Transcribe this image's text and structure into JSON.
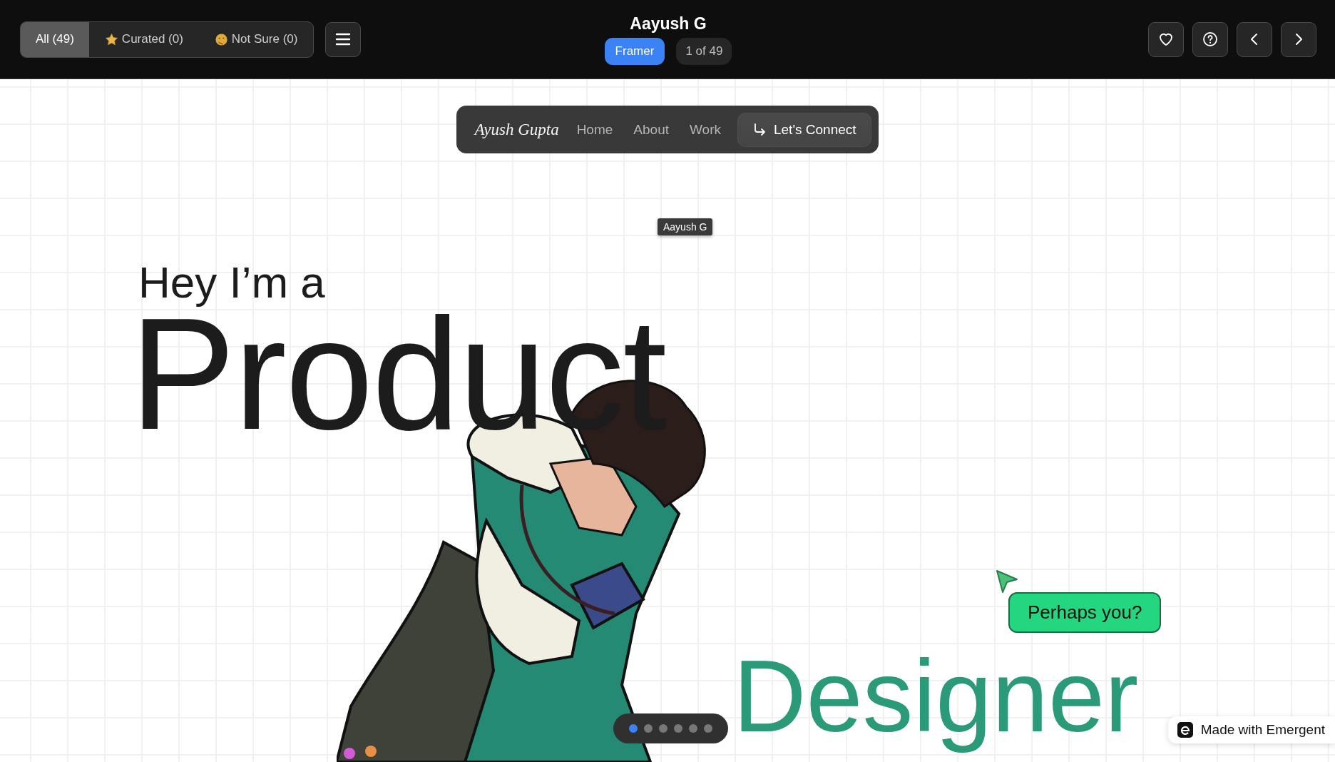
{
  "top_bar": {
    "filters": [
      {
        "label": "All (49)",
        "kind": "plain",
        "selected": true
      },
      {
        "label": "Curated (0)",
        "kind": "starred",
        "selected": false
      },
      {
        "label": "Not Sure (0)",
        "kind": "unsure",
        "selected": false
      }
    ],
    "title": "Aayush G",
    "platform": "Framer",
    "counter": "1 of 49",
    "actions": [
      {
        "kind": "heart"
      },
      {
        "kind": "help"
      },
      {
        "kind": "prev"
      },
      {
        "kind": "next"
      }
    ]
  },
  "site": {
    "nav": {
      "brand": "Ayush Gupta",
      "links": [
        "Home",
        "About",
        "Work"
      ],
      "cta": "Let's Connect"
    },
    "tooltip": "Aayush G",
    "greeting": "Hey I’m a",
    "headline": "Product",
    "headline_2": "Designer",
    "callout": "Perhaps you?",
    "slides": [
      {
        "selected": true
      },
      {
        "selected": false
      },
      {
        "selected": false
      },
      {
        "selected": false
      },
      {
        "selected": false
      },
      {
        "selected": false
      }
    ],
    "badge": "Made with Emergent"
  }
}
